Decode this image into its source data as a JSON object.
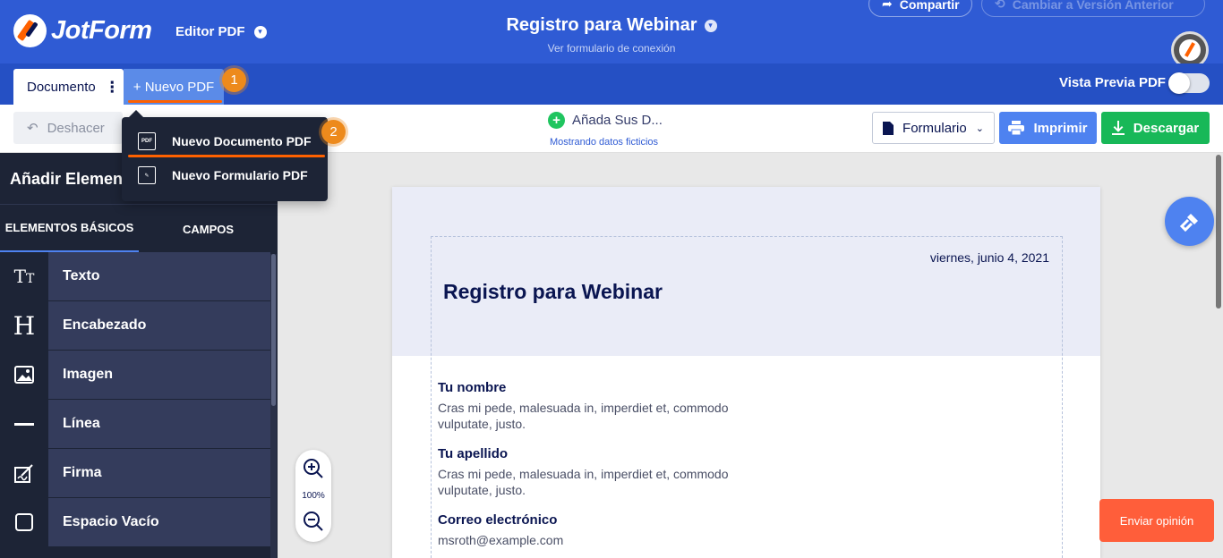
{
  "app": {
    "brand": "JotForm",
    "editor_label": "Editor PDF",
    "form_title": "Registro para Webinar",
    "form_subtitle": "Ver formulario de conexión",
    "share_label": "Compartir",
    "old_version_label": "Cambiar a Versión Anterior"
  },
  "tabs": {
    "document": "Documento",
    "new_pdf": "+ Nuevo PDF",
    "preview_label": "Vista Previa PDF",
    "preview_on": false
  },
  "callouts": {
    "one": "1",
    "two": "2"
  },
  "toolbar": {
    "undo": "Deshacer",
    "add_data": "Añada Sus D...",
    "showing_fake": "Mostrando datos ficticios",
    "form_select": "Formulario",
    "print": "Imprimir",
    "download": "Descargar"
  },
  "dropdown": {
    "items": [
      {
        "label": "Nuevo Documento PDF",
        "icon": "pdf-document-icon"
      },
      {
        "label": "Nuevo Formulario PDF",
        "icon": "form-edit-icon"
      }
    ]
  },
  "sidebar": {
    "title": "Añadir Elementos",
    "tab_basic": "ELEMENTOS BÁSICOS",
    "tab_fields": "CAMPOS",
    "items": [
      {
        "label": "Texto",
        "icon": "text-icon"
      },
      {
        "label": "Encabezado",
        "icon": "heading-icon"
      },
      {
        "label": "Imagen",
        "icon": "image-icon"
      },
      {
        "label": "Línea",
        "icon": "line-icon"
      },
      {
        "label": "Firma",
        "icon": "signature-icon"
      },
      {
        "label": "Espacio Vacío",
        "icon": "empty-space-icon"
      }
    ]
  },
  "page": {
    "date": "viernes, junio 4, 2021",
    "title": "Registro para Webinar",
    "fields": [
      {
        "question": "Tu nombre",
        "answer": "Cras mi pede, malesuada in, imperdiet et, commodo vulputate, justo."
      },
      {
        "question": "Tu apellido",
        "answer": "Cras mi pede, malesuada in, imperdiet et, commodo vulputate, justo."
      },
      {
        "question": "Correo electrónico",
        "answer": "msroth@example.com"
      }
    ]
  },
  "zoom": {
    "level": "100%"
  },
  "feedback": "Enviar opinión",
  "colors": {
    "header": "#2f5bd4",
    "accent_orange": "#ff6100",
    "sidebar": "#1d2436",
    "print": "#4e82f0",
    "download": "#18b858"
  }
}
